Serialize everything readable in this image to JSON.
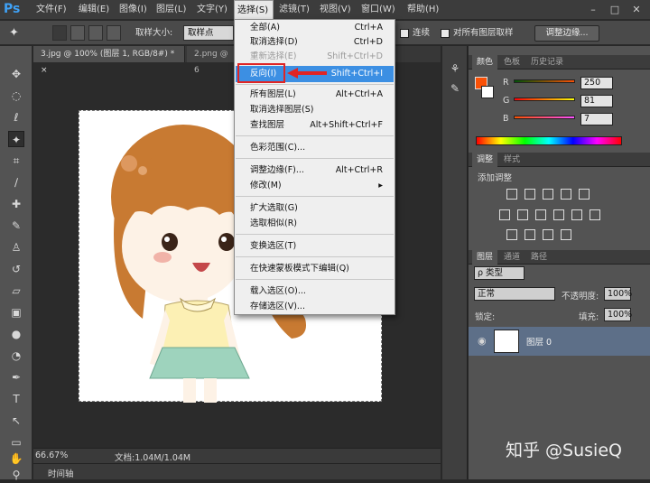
{
  "app": {
    "logo": "Ps"
  },
  "menubar": {
    "items": [
      "文件(F)",
      "编辑(E)",
      "图像(I)",
      "图层(L)",
      "文字(Y)",
      "选择(S)",
      "滤镜(T)",
      "视图(V)",
      "窗口(W)",
      "帮助(H)"
    ],
    "active": "选择(S)",
    "window_buttons": [
      "–",
      "□",
      "✕"
    ]
  },
  "options": {
    "sample_size_label": "取样大小:",
    "sample_size_value": "取样点",
    "contiguous_label": "连续",
    "all_layers_label": "对所有图层取样",
    "refine_button": "调整边缘..."
  },
  "tabs": [
    {
      "label": "3.jpg @ 100% (图层 1, RGB/8#) *",
      "close": "×"
    },
    {
      "label": "2.png @ 6",
      "close": ""
    }
  ],
  "select_menu": {
    "items": [
      {
        "label": "全部(A)",
        "shortcut": "Ctrl+A",
        "disabled": false
      },
      {
        "label": "取消选择(D)",
        "shortcut": "Ctrl+D",
        "disabled": false
      },
      {
        "label": "重新选择(E)",
        "shortcut": "Shift+Ctrl+D",
        "disabled": true
      },
      {
        "label": "反向(I)",
        "shortcut": "Shift+Ctrl+I",
        "highlighted": true
      },
      {
        "label": "所有图层(L)",
        "shortcut": "Alt+Ctrl+A"
      },
      {
        "label": "取消选择图层(S)",
        "shortcut": ""
      },
      {
        "label": "查找图层",
        "shortcut": "Alt+Shift+Ctrl+F"
      },
      {
        "label": "色彩范围(C)...",
        "shortcut": ""
      },
      {
        "label": "调整边缘(F)...",
        "shortcut": "Alt+Ctrl+R"
      },
      {
        "label": "修改(M)",
        "shortcut": "▸"
      },
      {
        "label": "扩大选取(G)",
        "shortcut": ""
      },
      {
        "label": "选取相似(R)",
        "shortcut": ""
      },
      {
        "label": "变换选区(T)",
        "shortcut": ""
      },
      {
        "label": "在快速蒙板模式下编辑(Q)",
        "shortcut": ""
      },
      {
        "label": "载入选区(O)...",
        "shortcut": ""
      },
      {
        "label": "存储选区(V)...",
        "shortcut": ""
      }
    ]
  },
  "status": {
    "zoom": "66.67%",
    "doc": "文档:1.04M/1.04M",
    "timeline": "时间轴"
  },
  "color_panel": {
    "tabs": [
      "颜色",
      "色板",
      "历史记录"
    ],
    "r_label": "R",
    "g_label": "G",
    "b_label": "B",
    "r": 250,
    "g": 81,
    "b": 7,
    "fg_color": "#fa5107"
  },
  "adjust_panel": {
    "tabs": [
      "调整",
      "样式"
    ],
    "title": "添加调整"
  },
  "layers_panel": {
    "tabs": [
      "图层",
      "通道",
      "路径"
    ],
    "filter": "ρ 类型",
    "blend_mode": "正常",
    "opacity_label": "不透明度:",
    "opacity": "100%",
    "lock_label": "锁定:",
    "fill_label": "填充:",
    "fill": "100%",
    "layer_name": "图层 0"
  },
  "watermark": "知乎 @SusieQ"
}
